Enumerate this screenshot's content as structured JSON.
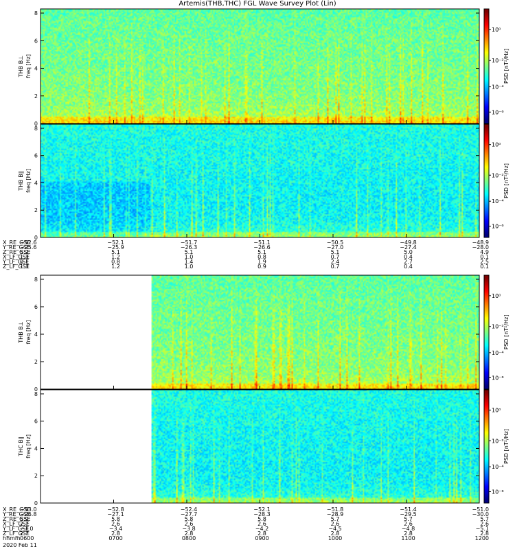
{
  "title": "Artemis(THB,THC) FGL Wave Survey Plot (Lin)",
  "colorbar": {
    "label": "PSD [nT²/Hz]",
    "ticks": [
      "10⁰",
      "10⁻²",
      "10⁻⁴",
      "10⁻⁶"
    ]
  },
  "chart_data": [
    {
      "type": "heatmap",
      "panel": "top-1",
      "ylabel_line1": "THB B⊥",
      "ylabel_line2": "freq [Hz]",
      "y_ticks": [
        "0",
        "2",
        "4",
        "6",
        "8"
      ],
      "ylim": [
        0,
        8.3
      ],
      "log_color_scale": true,
      "data_start_fraction": 0.0,
      "base_level": "green-cyan",
      "bursts": "yellow-green streaks near low frequencies"
    },
    {
      "type": "heatmap",
      "panel": "top-2",
      "ylabel_line1": "THB B∥",
      "ylabel_line2": "freq [Hz]",
      "y_ticks": [
        "0",
        "2",
        "4",
        "6",
        "8"
      ],
      "ylim": [
        0,
        8.3
      ],
      "log_color_scale": true,
      "data_start_fraction": 0.0,
      "base_level": "cyan-blue"
    },
    {
      "type": "heatmap",
      "panel": "bottom-1",
      "ylabel_line1": "THB B⊥",
      "ylabel_line2": "freq [Hz]",
      "y_ticks": [
        "0",
        "2",
        "4",
        "6",
        "8"
      ],
      "ylim": [
        0,
        8.3
      ],
      "log_color_scale": true,
      "data_start_fraction": 0.253,
      "base_level": "green-cyan"
    },
    {
      "type": "heatmap",
      "panel": "bottom-2",
      "ylabel_line1": "THC B∥",
      "ylabel_line2": "freq [Hz]",
      "y_ticks": [
        "0",
        "2",
        "4",
        "6",
        "8"
      ],
      "ylim": [
        0,
        8.3
      ],
      "log_color_scale": true,
      "data_start_fraction": 0.253,
      "base_level": "cyan-blue"
    }
  ],
  "ephemeris_top": {
    "rows": [
      {
        "label": "X_RE_GSE",
        "values": [
          "−52.6",
          "−52.1",
          "−51.7",
          "−51.1",
          "−50.5",
          "−49.8",
          "−48.9"
        ]
      },
      {
        "label": "Y_RE_GSE",
        "values": [
          "−25.6",
          "−25.9",
          "−26.3",
          "−26.6",
          "−27.0",
          "−27.4",
          "−28.0"
        ]
      },
      {
        "label": "Z_RE_GSE",
        "values": [
          "5.2",
          "5.1",
          "5.1",
          "5.1",
          "5.1",
          "5.0",
          "4.9"
        ]
      },
      {
        "label": "X_LF_GSE",
        "values": [
          "1.3",
          "1.2",
          "1.0",
          "0.8",
          "0.7",
          "0.4",
          "0.1"
        ]
      },
      {
        "label": "Y_LF_GSE",
        "values": [
          "0.1",
          "0.8",
          "1.4",
          "1.9",
          "2.4",
          "2.7",
          "2.5"
        ]
      },
      {
        "label": "Z_LF_GSE",
        "values": [
          "1.3",
          "1.2",
          "1.0",
          "0.9",
          "0.7",
          "0.4",
          "0.1"
        ]
      }
    ]
  },
  "ephemeris_bottom": {
    "rows": [
      {
        "label": "X_RE_GSE",
        "values": [
          "−53.0",
          "−52.8",
          "−52.4",
          "−52.1",
          "−51.8",
          "−51.4",
          "−51.0"
        ]
      },
      {
        "label": "Y_RE_GSE",
        "values": [
          "−26.8",
          "−27.1",
          "−27.7",
          "−28.3",
          "−28.9",
          "−29.5",
          "−30.0"
        ]
      },
      {
        "label": "Z_RE_GSE",
        "values": [
          "5.9",
          "5.8",
          "5.8",
          "5.8",
          "5.7",
          "5.7",
          "5.7"
        ]
      },
      {
        "label": "X_LF_GSE",
        "values": [
          "2.7",
          "2.6",
          "2.6",
          "2.6",
          "2.6",
          "2.6",
          "2.6"
        ]
      },
      {
        "label": "Y_LF_GSE",
        "values": [
          "−3.0",
          "−3.4",
          "−3.8",
          "−4.2",
          "−4.5",
          "−4.8",
          "−5.1"
        ]
      },
      {
        "label": "Z_LF_GSE",
        "values": [
          "2.7",
          "2.8",
          "2.8",
          "2.8",
          "2.8",
          "2.8",
          "2.8"
        ]
      },
      {
        "label": "hhmm",
        "values": [
          "0600",
          "0700",
          "0800",
          "0900",
          "1000",
          "1100",
          "1200"
        ]
      }
    ],
    "date": "2020 Feb 11"
  }
}
